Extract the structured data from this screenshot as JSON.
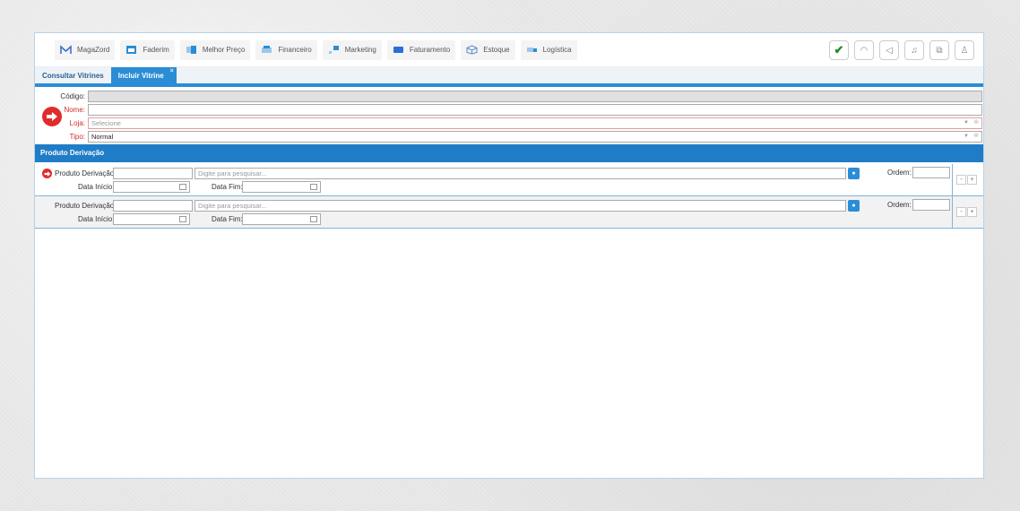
{
  "nav": {
    "items": [
      {
        "label": "MagaZord",
        "icon": "magazord-logo-icon",
        "color": "#3b6fd1"
      },
      {
        "label": "Faderim",
        "icon": "window-icon",
        "color": "#2a8dd6"
      },
      {
        "label": "Melhor Preço",
        "icon": "price-tag-icon",
        "color": "#2a8dd6"
      },
      {
        "label": "Financeiro",
        "icon": "money-icon",
        "color": "#2a8dd6"
      },
      {
        "label": "Marketing",
        "icon": "chart-icon",
        "color": "#2a8dd6"
      },
      {
        "label": "Faturamento",
        "icon": "invoice-icon",
        "color": "#2a6fd6"
      },
      {
        "label": "Estoque",
        "icon": "box-icon",
        "color": "#5a8ac6"
      },
      {
        "label": "Logística",
        "icon": "truck-icon",
        "color": "#2a8dd6"
      }
    ],
    "right_buttons": [
      "check-icon",
      "headset-icon",
      "megaphone-icon",
      "bell-icon",
      "external-link-icon",
      "user-icon"
    ]
  },
  "tabs": [
    {
      "label": "Consultar Vitrines",
      "active": false
    },
    {
      "label": "Incluir Vitrine",
      "active": true,
      "close": "×"
    }
  ],
  "form": {
    "codigo_label": "Código:",
    "codigo_value": "",
    "nome_label": "Nome:",
    "nome_value": "",
    "loja_label": "Loja:",
    "loja_placeholder": "Selecione",
    "tipo_label": "Tipo:",
    "tipo_value": "Normal"
  },
  "section_title": "Produto Derivação",
  "derivacao": {
    "produto_label": "Produto Derivação:",
    "search_placeholder": "Digite para pesquisar...",
    "ordem_label": "Ordem:",
    "data_inicio_label": "Data Início:",
    "data_fim_label": "Data Fim:",
    "minus": "-",
    "plus": "+"
  },
  "colors": {
    "accent": "#2a8dd6",
    "section": "#1f7cc6",
    "required": "#d62b2b",
    "ok": "#1e8a2a"
  }
}
